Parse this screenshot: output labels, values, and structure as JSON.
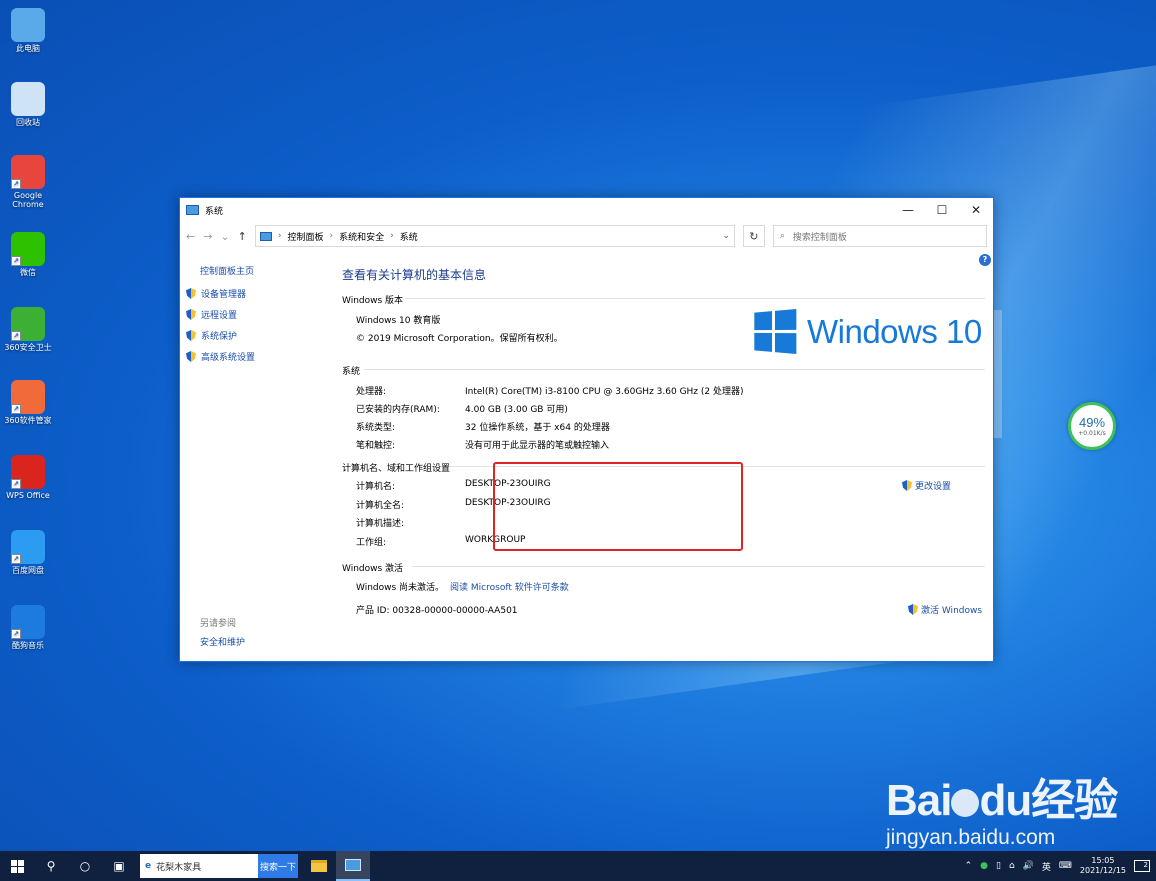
{
  "desktop": {
    "icons": [
      {
        "label": "此电脑",
        "icon": "computer-icon",
        "color": "#5aa9e8"
      },
      {
        "label": "回收站",
        "icon": "recycle-bin-icon",
        "color": "#cfe3f7"
      },
      {
        "label": "Google Chrome",
        "icon": "chrome-icon",
        "color": "#e8453c"
      },
      {
        "label": "微信",
        "icon": "wechat-icon",
        "color": "#2dc100"
      },
      {
        "label": "360安全卫士",
        "icon": "360-security-icon",
        "color": "#3cb034"
      },
      {
        "label": "360软件管家",
        "icon": "360-software-icon",
        "color": "#f06a3a"
      },
      {
        "label": "WPS Office",
        "icon": "wps-icon",
        "color": "#d9251d"
      },
      {
        "label": "百度网盘",
        "icon": "baidu-netdisk-icon",
        "color": "#2b9cf2"
      },
      {
        "label": "酷狗音乐",
        "icon": "kugou-icon",
        "color": "#1d7be0"
      }
    ]
  },
  "window": {
    "title": "系统",
    "controls": {
      "minimize": "—",
      "maximize": "☐",
      "close": "✕"
    },
    "address": {
      "back": "←",
      "forward": "→",
      "recent": "⌄",
      "up": "↑",
      "crumbs": [
        "控制面板",
        "系统和安全",
        "系统"
      ],
      "dropdown": "⌄",
      "refresh": "↻",
      "search_placeholder": "搜索控制面板",
      "search_icon": "⌕"
    },
    "sidebar": {
      "home": "控制面板主页",
      "links": [
        "设备管理器",
        "远程设置",
        "系统保护",
        "高级系统设置"
      ],
      "see_also": "另请参阅",
      "see_also_link": "安全和维护"
    },
    "main": {
      "page_title": "查看有关计算机的基本信息",
      "help": "?",
      "edition_section": "Windows 版本",
      "edition": "Windows 10 教育版",
      "copyright": "© 2019 Microsoft Corporation。保留所有权利。",
      "logo_text": "Windows 10",
      "system_section": "系统",
      "system_rows": [
        {
          "key": "处理器:",
          "value": "Intel(R) Core(TM) i3-8100 CPU @ 3.60GHz   3.60 GHz  (2 处理器)"
        },
        {
          "key": "已安装的内存(RAM):",
          "value": "4.00 GB (3.00 GB 可用)"
        },
        {
          "key": "系统类型:",
          "value": "32 位操作系统，基于 x64 的处理器"
        },
        {
          "key": "笔和触控:",
          "value": "没有可用于此显示器的笔或触控输入"
        }
      ],
      "computer_section": "计算机名、域和工作组设置",
      "computer_rows": [
        {
          "key": "计算机名:",
          "value": "DESKTOP-23OUIRG"
        },
        {
          "key": "计算机全名:",
          "value": "DESKTOP-23OUIRG"
        },
        {
          "key": "计算机描述:",
          "value": ""
        },
        {
          "key": "工作组:",
          "value": "WORKGROUP"
        }
      ],
      "change_settings": "更改设置",
      "activation_section": "Windows 激活",
      "activation_status": "Windows 尚未激活。",
      "license_link": "阅读 Microsoft 软件许可条款",
      "product_id": "产品 ID: 00328-00000-00000-AA501",
      "activate": "激活 Windows"
    }
  },
  "gauge": {
    "percent": "49%",
    "speed": "+0.01K/s"
  },
  "watermark": {
    "brand_a": "Bai",
    "brand_b": "du",
    "brand_c": "经验",
    "url": "jingyan.baidu.com"
  },
  "taskbar": {
    "search_text": "花梨木家具",
    "search_button": "搜索一下",
    "tray_ime": "英",
    "tray_volume": "🔊",
    "tray_notif_count": "2",
    "time": "15:05",
    "date": "2021/12/15"
  }
}
